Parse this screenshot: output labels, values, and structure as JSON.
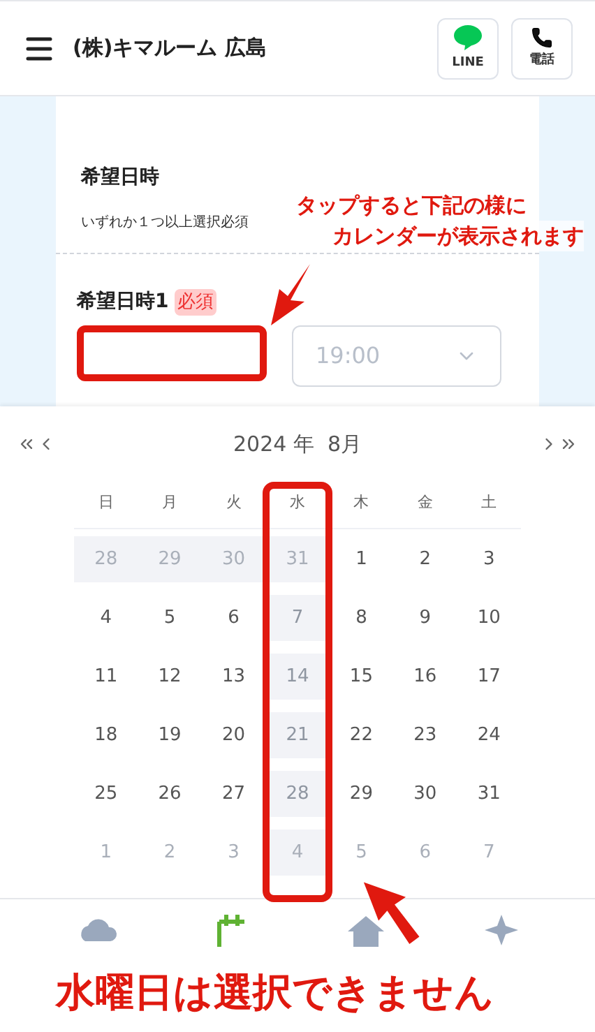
{
  "header": {
    "title": "(株)キマルーム 広島",
    "buttons": [
      {
        "kind": "line",
        "label": "LINE"
      },
      {
        "kind": "phone",
        "label": "電話"
      }
    ]
  },
  "form": {
    "section_title": "希望日時",
    "section_note": "いずれか１つ以上選択必須",
    "field_label": "希望日時1",
    "required_badge": "必須",
    "time_value": "19:00"
  },
  "calendar": {
    "title": "2024 年  8月",
    "weekdays": [
      "日",
      "月",
      "火",
      "水",
      "木",
      "金",
      "土"
    ],
    "weeks": [
      [
        {
          "label": "28",
          "outside": true,
          "disabled": true
        },
        {
          "label": "29",
          "outside": true,
          "disabled": true
        },
        {
          "label": "30",
          "outside": true,
          "disabled": true
        },
        {
          "label": "31",
          "outside": true,
          "disabled": true
        },
        {
          "label": "1",
          "outside": false,
          "disabled": false
        },
        {
          "label": "2",
          "outside": false,
          "disabled": false
        },
        {
          "label": "3",
          "outside": false,
          "disabled": false
        }
      ],
      [
        {
          "label": "4",
          "outside": false,
          "disabled": false
        },
        {
          "label": "5",
          "outside": false,
          "disabled": false
        },
        {
          "label": "6",
          "outside": false,
          "disabled": false
        },
        {
          "label": "7",
          "outside": false,
          "disabled": true
        },
        {
          "label": "8",
          "outside": false,
          "disabled": false
        },
        {
          "label": "9",
          "outside": false,
          "disabled": false
        },
        {
          "label": "10",
          "outside": false,
          "disabled": false
        }
      ],
      [
        {
          "label": "11",
          "outside": false,
          "disabled": false
        },
        {
          "label": "12",
          "outside": false,
          "disabled": false
        },
        {
          "label": "13",
          "outside": false,
          "disabled": false
        },
        {
          "label": "14",
          "outside": false,
          "disabled": true
        },
        {
          "label": "15",
          "outside": false,
          "disabled": false
        },
        {
          "label": "16",
          "outside": false,
          "disabled": false
        },
        {
          "label": "17",
          "outside": false,
          "disabled": false
        }
      ],
      [
        {
          "label": "18",
          "outside": false,
          "disabled": false
        },
        {
          "label": "19",
          "outside": false,
          "disabled": false
        },
        {
          "label": "20",
          "outside": false,
          "disabled": false
        },
        {
          "label": "21",
          "outside": false,
          "disabled": true
        },
        {
          "label": "22",
          "outside": false,
          "disabled": false
        },
        {
          "label": "23",
          "outside": false,
          "disabled": false
        },
        {
          "label": "24",
          "outside": false,
          "disabled": false
        }
      ],
      [
        {
          "label": "25",
          "outside": false,
          "disabled": false
        },
        {
          "label": "26",
          "outside": false,
          "disabled": false
        },
        {
          "label": "27",
          "outside": false,
          "disabled": false
        },
        {
          "label": "28",
          "outside": false,
          "disabled": true
        },
        {
          "label": "29",
          "outside": false,
          "disabled": false
        },
        {
          "label": "30",
          "outside": false,
          "disabled": false
        },
        {
          "label": "31",
          "outside": false,
          "disabled": false
        }
      ],
      [
        {
          "label": "1",
          "outside": true,
          "disabled": false
        },
        {
          "label": "2",
          "outside": true,
          "disabled": false
        },
        {
          "label": "3",
          "outside": true,
          "disabled": false
        },
        {
          "label": "4",
          "outside": true,
          "disabled": true
        },
        {
          "label": "5",
          "outside": true,
          "disabled": false
        },
        {
          "label": "6",
          "outside": true,
          "disabled": false
        },
        {
          "label": "7",
          "outside": true,
          "disabled": false
        }
      ]
    ]
  },
  "annotations": {
    "tap_note": [
      "タップすると下記の様に",
      "カレンダーが表示されます"
    ],
    "bottom_note": "水曜日は選択できません"
  }
}
